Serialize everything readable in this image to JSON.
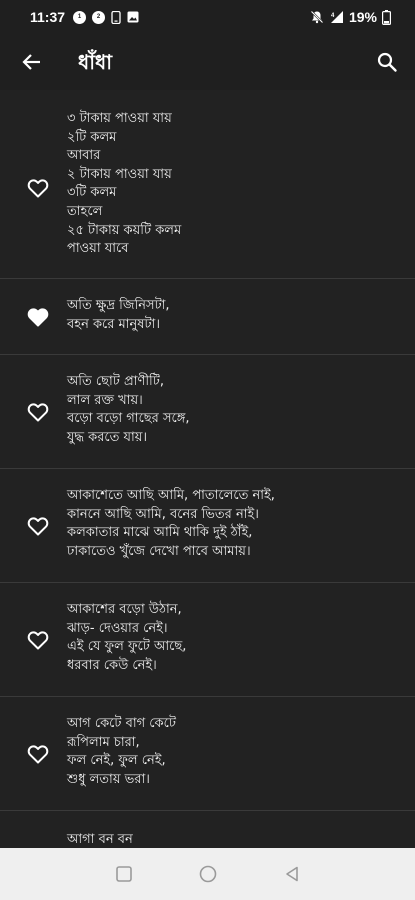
{
  "status_bar": {
    "time": "11:37",
    "notification_icons": [
      "sim-icon",
      "sim-icon",
      "phone-icon",
      "image-icon"
    ],
    "sim_badges": [
      "1",
      "2"
    ],
    "battery": "19%"
  },
  "app_bar": {
    "title": "ধাঁধা",
    "back_icon": "arrow-back-icon",
    "search_icon": "search-icon"
  },
  "riddles": [
    {
      "favorited": false,
      "text": "৩ টাকায় পাওয়া যায়\n২টি কলম\nআবার\n২ টাকায় পাওয়া যায়\n৩টি কলম\nতাহলে\n২৫ টাকায় কয়টি কলম\nপাওয়া যাবে"
    },
    {
      "favorited": true,
      "text": "অতি ক্ষুদ্র জিনিসটা,\nবহন করে মানুষটা।"
    },
    {
      "favorited": false,
      "text": "অতি ছোট প্রাণীটি,\nলাল রক্ত খায়।\nবড়ো বড়ো গাছের সঙ্গে,\nযুদ্ধ করতে যায়।"
    },
    {
      "favorited": false,
      "text": "আকাশেতে আছি আমি, পাতালেতে নাই,\nকাননে আছি আমি, বনের ভিতর নাই।\nকলকাতার মাঝে আমি থাকি দুই ঠাঁই,\nঢাকাতেও খুঁজে দেখো পাবে আমায়।"
    },
    {
      "favorited": false,
      "text": "আকাশের বড়ো উঠান,\nঝাড়- দেওয়ার নেই।\nএই যে ফুল ফুটে আছে,\nধরবার কেউ নেই।"
    },
    {
      "favorited": false,
      "text": "আগ কেটে বাগ কেটে\nরূপিলাম চারা,\nফল নেই, ফুল নেই,\nশুধু লতায় ভরা।"
    },
    {
      "favorited": false,
      "text": "আগা বন বন"
    }
  ],
  "nav_bar": {
    "icons": [
      "recents-square-icon",
      "home-circle-icon",
      "back-triangle-icon"
    ]
  },
  "colors": {
    "background": "#222222",
    "app_bar": "#1f1f1f",
    "divider": "#3a3a3a",
    "text": "#f2f2f2",
    "nav_bar": "#efefef"
  }
}
